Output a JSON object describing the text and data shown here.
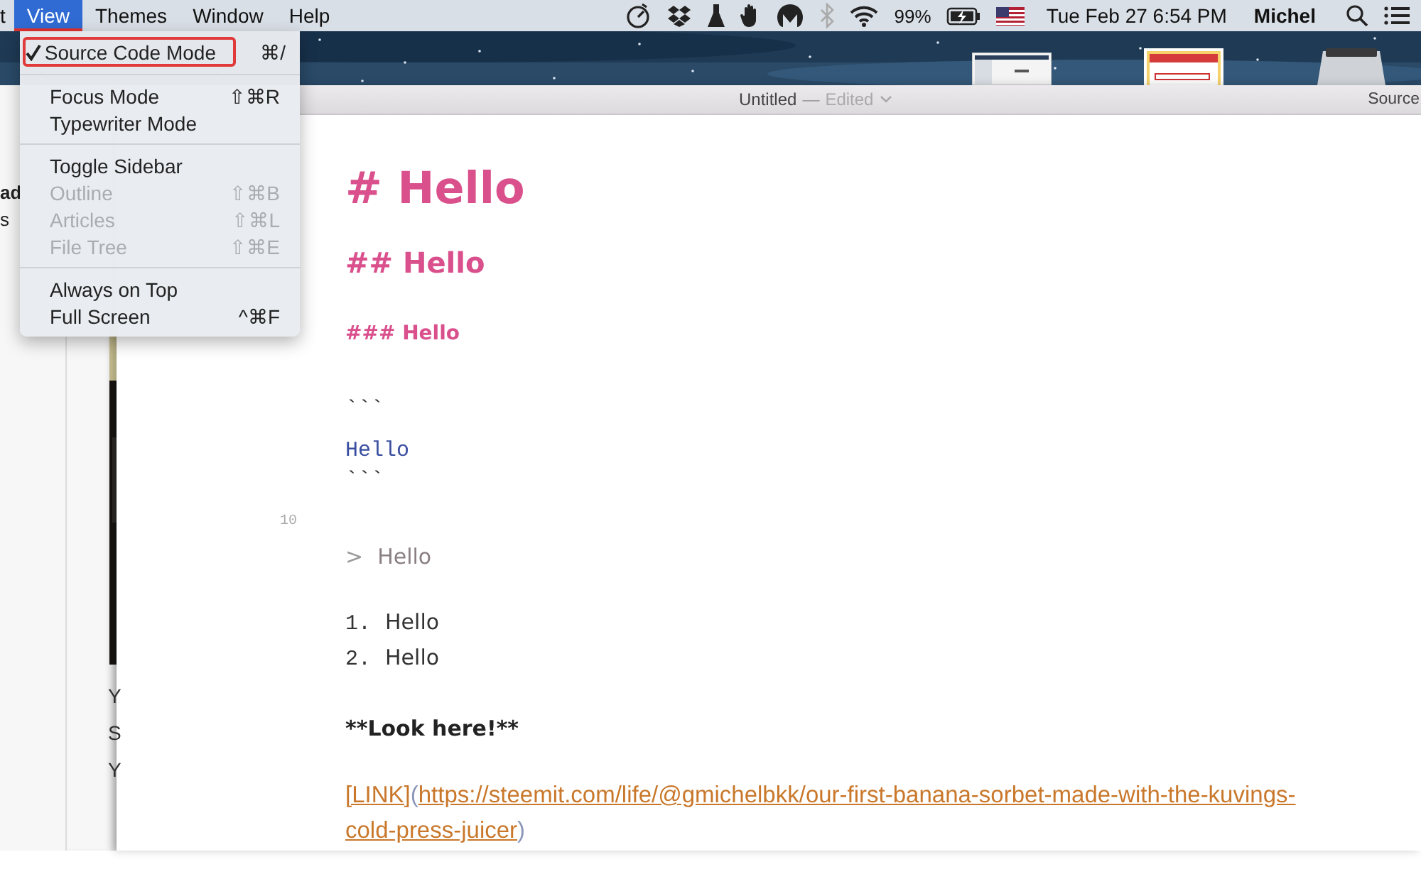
{
  "menubar": {
    "items": [
      {
        "label": "t",
        "selected": false
      },
      {
        "label": "View",
        "selected": true
      },
      {
        "label": "Themes",
        "selected": false
      },
      {
        "label": "Window",
        "selected": false
      },
      {
        "label": "Help",
        "selected": false
      }
    ],
    "battery": "99%",
    "datetime": "Tue Feb 27  6:54 PM",
    "user": "Michel"
  },
  "view_menu": {
    "sections": [
      [
        {
          "label": "Source Code Mode",
          "shortcut": "⌘/",
          "checked": true,
          "disabled": false,
          "outlined": true
        }
      ],
      [
        {
          "label": "Focus Mode",
          "shortcut": "⇧⌘R",
          "checked": false,
          "disabled": false,
          "outlined": false
        },
        {
          "label": "Typewriter Mode",
          "checked": false,
          "disabled": false,
          "outlined": false
        }
      ],
      [
        {
          "label": "Toggle Sidebar",
          "checked": false,
          "disabled": false,
          "outlined": false
        },
        {
          "label": "Outline",
          "shortcut": "⇧⌘B",
          "checked": false,
          "disabled": true,
          "outlined": false
        },
        {
          "label": "Articles",
          "shortcut": "⇧⌘L",
          "checked": false,
          "disabled": true,
          "outlined": false
        },
        {
          "label": "File Tree",
          "shortcut": "⇧⌘E",
          "checked": false,
          "disabled": true,
          "outlined": false
        }
      ],
      [
        {
          "label": "Always on Top",
          "checked": false,
          "disabled": false,
          "outlined": false
        },
        {
          "label": "Full Screen",
          "shortcut": "^⌘F",
          "checked": false,
          "disabled": false,
          "outlined": false
        }
      ]
    ]
  },
  "window": {
    "title": "Untitled",
    "separator": "—",
    "status": "Edited",
    "toolbar_right": "Source"
  },
  "back_window": {
    "sidebar_fragments": [
      "ad",
      "s"
    ],
    "text_fragments": [
      "Y",
      "S",
      "Y"
    ]
  },
  "editor": {
    "lines": [
      {
        "kind": "h1",
        "text": "# Hello"
      },
      {
        "kind": "h2",
        "text": "## Hello"
      },
      {
        "kind": "h3",
        "text": "### Hello"
      },
      {
        "kind": "fence",
        "text": "```"
      },
      {
        "kind": "code",
        "text": "Hello"
      },
      {
        "kind": "fence",
        "text": "```"
      },
      {
        "kind": "blank",
        "number": "10"
      },
      {
        "kind": "quote",
        "marker": ">",
        "text": "Hello"
      },
      {
        "kind": "list",
        "marker": "1.",
        "text": "Hello"
      },
      {
        "kind": "list",
        "marker": "2.",
        "text": "Hello"
      },
      {
        "kind": "bold",
        "text": "**Look here!**"
      },
      {
        "kind": "link",
        "label": "[LINK]",
        "open": "(",
        "url": "https://steemit.com/life/@gmichelbkk/our-first-banana-sorbet-made-with-the-kuvings-cold-press-juicer",
        "close": ")"
      }
    ]
  }
}
